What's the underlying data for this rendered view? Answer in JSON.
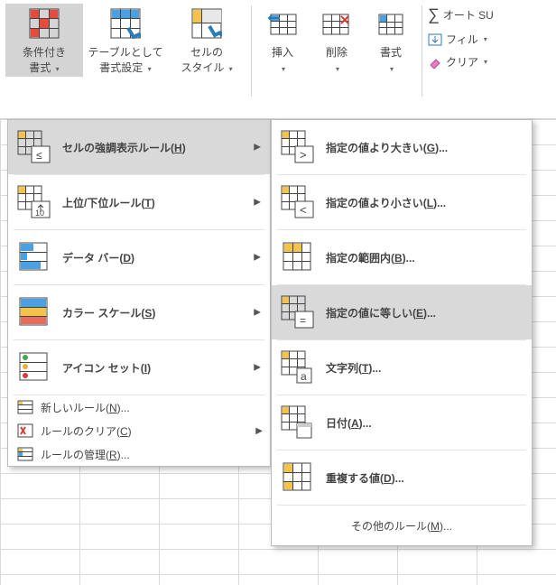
{
  "ribbon": {
    "conditional_format": "条件付き\n書式",
    "table_format": "テーブルとして\n書式設定",
    "cell_styles": "セルの\nスタイル",
    "insert": "挿入",
    "delete": "削除",
    "format": "書式",
    "autosum": "オート SU",
    "fill": "フィル",
    "clear": "クリア"
  },
  "menu1": {
    "highlight": "セルの強調表示ルール",
    "highlight_k": "H",
    "topbottom_a": "上位",
    "topbottom_b": "下位ルール",
    "topbottom_k": "T",
    "databars": "データ バー",
    "databars_k": "D",
    "colorscales": "カラー スケール",
    "colorscales_k": "S",
    "iconsets": "アイコン セット",
    "iconsets_k": "I",
    "new_a": "新しいルール(",
    "new_k": "N",
    "new_b": ")...",
    "clear_a": "ルールのクリア(",
    "clear_k": "C",
    "clear_b": ")",
    "manage_a": "ルールの管理(",
    "manage_k": "R",
    "manage_b": ")..."
  },
  "menu2": {
    "gt_a": "指定の値より大きい(",
    "gt_k": "G",
    "gt_b": ")...",
    "lt_a": "指定の値より小さい(",
    "lt_k": "L",
    "lt_b": ")...",
    "bt_a": "指定の範囲内(",
    "bt_k": "B",
    "bt_b": ")...",
    "eq_a": "指定の値に等しい(",
    "eq_k": "E",
    "eq_b": ")...",
    "tx_a": "文字列(",
    "tx_k": "T",
    "tx_b": ")...",
    "dt_a": "日付(",
    "dt_k": "A",
    "dt_b": ")...",
    "dp_a": "重複する値(",
    "dp_k": "D",
    "dp_b": ")...",
    "more_a": "その他のルール(",
    "more_k": "M",
    "more_b": ")..."
  }
}
